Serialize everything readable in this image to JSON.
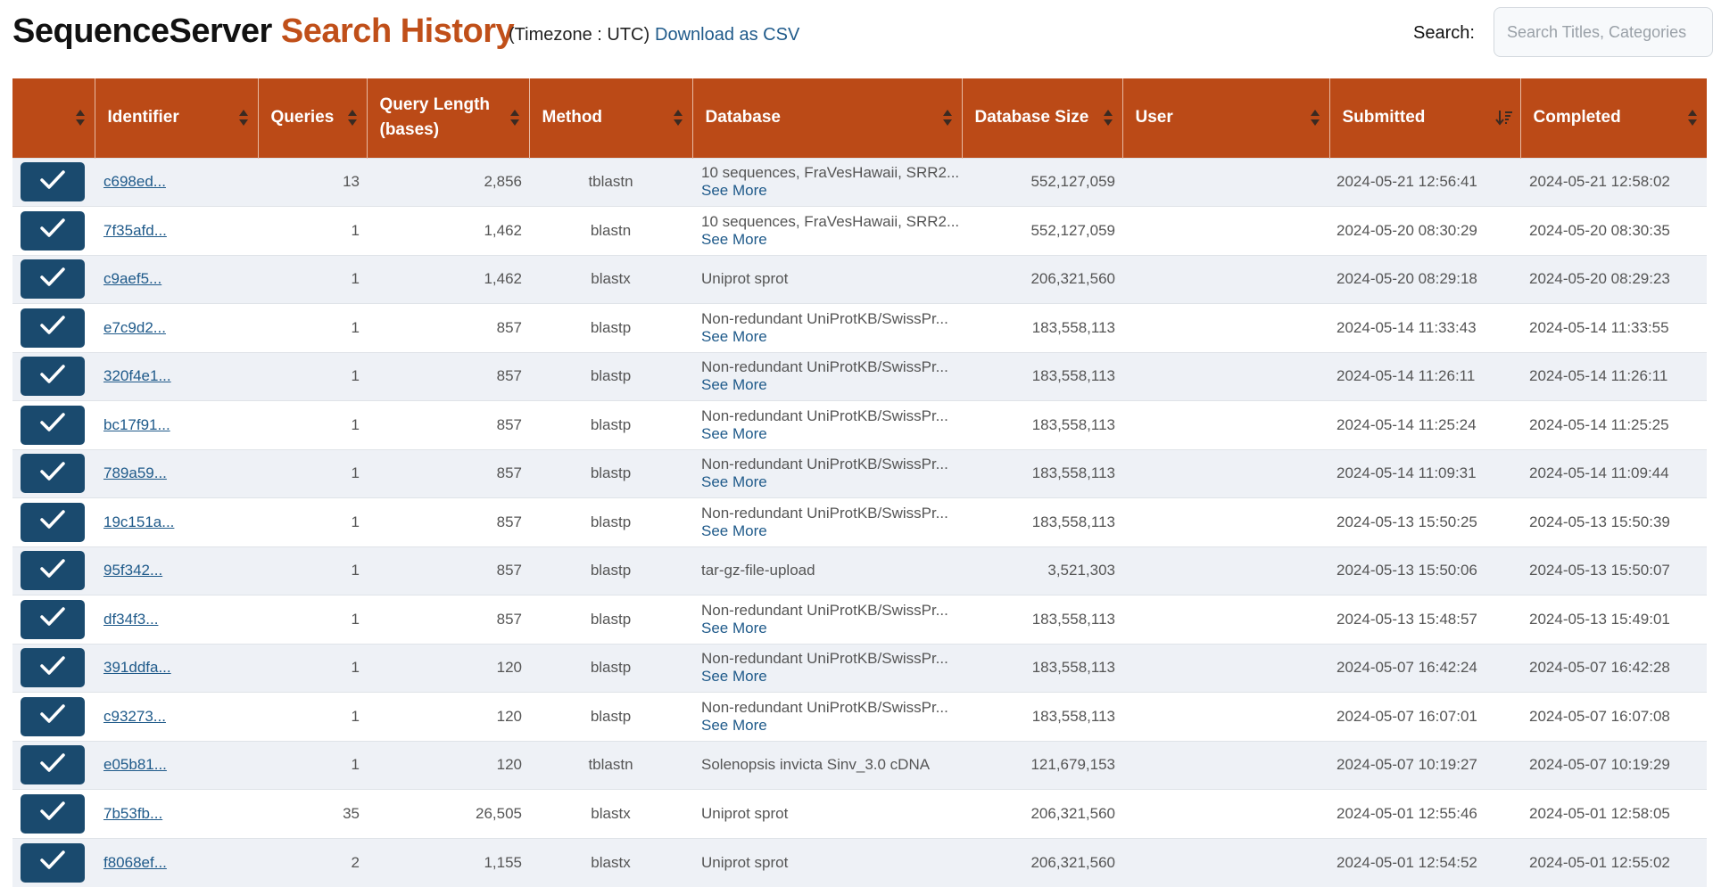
{
  "header": {
    "title_part1": "SequenceServer",
    "title_part2": "Search History",
    "timezone": "(Timezone : UTC)",
    "download_csv": "Download as CSV",
    "search_label": "Search:",
    "search_placeholder": "Search Titles, Categories",
    "search_value": ""
  },
  "colors": {
    "accent": "#bb4a17",
    "title_accent": "#c04f19",
    "link": "#1f5a8a",
    "checkbox": "#1a4a6e",
    "row_alt": "#eef1f6"
  },
  "table": {
    "columns": [
      {
        "label": "",
        "sort": "unsorted"
      },
      {
        "label": "Identifier",
        "sort": "unsorted"
      },
      {
        "label": "Queries",
        "sort": "unsorted"
      },
      {
        "label": "Query Length (bases)",
        "sort": "unsorted"
      },
      {
        "label": "Method",
        "sort": "unsorted"
      },
      {
        "label": "Database",
        "sort": "unsorted"
      },
      {
        "label": "Database Size",
        "sort": "unsorted"
      },
      {
        "label": "User",
        "sort": "unsorted"
      },
      {
        "label": "Submitted",
        "sort": "descending"
      },
      {
        "label": "Completed",
        "sort": "unsorted"
      }
    ],
    "see_more_label": "See More",
    "rows": [
      {
        "checked": true,
        "identifier": "c698ed...",
        "queries": "13",
        "query_length": "2,856",
        "method": "tblastn",
        "database": "10 sequences, FraVesHawaii, SRR2...",
        "see_more": true,
        "db_size": "552,127,059",
        "user": "",
        "submitted": "2024-05-21 12:56:41",
        "completed": "2024-05-21 12:58:02"
      },
      {
        "checked": true,
        "identifier": "7f35afd...",
        "queries": "1",
        "query_length": "1,462",
        "method": "blastn",
        "database": "10 sequences, FraVesHawaii, SRR2...",
        "see_more": true,
        "db_size": "552,127,059",
        "user": "",
        "submitted": "2024-05-20 08:30:29",
        "completed": "2024-05-20 08:30:35"
      },
      {
        "checked": true,
        "identifier": "c9aef5...",
        "queries": "1",
        "query_length": "1,462",
        "method": "blastx",
        "database": "Uniprot sprot",
        "see_more": false,
        "db_size": "206,321,560",
        "user": "",
        "submitted": "2024-05-20 08:29:18",
        "completed": "2024-05-20 08:29:23"
      },
      {
        "checked": true,
        "identifier": "e7c9d2...",
        "queries": "1",
        "query_length": "857",
        "method": "blastp",
        "database": "Non-redundant UniProtKB/SwissPr...",
        "see_more": true,
        "db_size": "183,558,113",
        "user": "",
        "submitted": "2024-05-14 11:33:43",
        "completed": "2024-05-14 11:33:55"
      },
      {
        "checked": true,
        "identifier": "320f4e1...",
        "queries": "1",
        "query_length": "857",
        "method": "blastp",
        "database": "Non-redundant UniProtKB/SwissPr...",
        "see_more": true,
        "db_size": "183,558,113",
        "user": "",
        "submitted": "2024-05-14 11:26:11",
        "completed": "2024-05-14 11:26:11"
      },
      {
        "checked": true,
        "identifier": "bc17f91...",
        "queries": "1",
        "query_length": "857",
        "method": "blastp",
        "database": "Non-redundant UniProtKB/SwissPr...",
        "see_more": true,
        "db_size": "183,558,113",
        "user": "",
        "submitted": "2024-05-14 11:25:24",
        "completed": "2024-05-14 11:25:25"
      },
      {
        "checked": true,
        "identifier": "789a59...",
        "queries": "1",
        "query_length": "857",
        "method": "blastp",
        "database": "Non-redundant UniProtKB/SwissPr...",
        "see_more": true,
        "db_size": "183,558,113",
        "user": "",
        "submitted": "2024-05-14 11:09:31",
        "completed": "2024-05-14 11:09:44"
      },
      {
        "checked": true,
        "identifier": "19c151a...",
        "queries": "1",
        "query_length": "857",
        "method": "blastp",
        "database": "Non-redundant UniProtKB/SwissPr...",
        "see_more": true,
        "db_size": "183,558,113",
        "user": "",
        "submitted": "2024-05-13 15:50:25",
        "completed": "2024-05-13 15:50:39"
      },
      {
        "checked": true,
        "identifier": "95f342...",
        "queries": "1",
        "query_length": "857",
        "method": "blastp",
        "database": "tar-gz-file-upload",
        "see_more": false,
        "db_size": "3,521,303",
        "user": "",
        "submitted": "2024-05-13 15:50:06",
        "completed": "2024-05-13 15:50:07"
      },
      {
        "checked": true,
        "identifier": "df34f3...",
        "queries": "1",
        "query_length": "857",
        "method": "blastp",
        "database": "Non-redundant UniProtKB/SwissPr...",
        "see_more": true,
        "db_size": "183,558,113",
        "user": "",
        "submitted": "2024-05-13 15:48:57",
        "completed": "2024-05-13 15:49:01"
      },
      {
        "checked": true,
        "identifier": "391ddfa...",
        "queries": "1",
        "query_length": "120",
        "method": "blastp",
        "database": "Non-redundant UniProtKB/SwissPr...",
        "see_more": true,
        "db_size": "183,558,113",
        "user": "",
        "submitted": "2024-05-07 16:42:24",
        "completed": "2024-05-07 16:42:28"
      },
      {
        "checked": true,
        "identifier": "c93273...",
        "queries": "1",
        "query_length": "120",
        "method": "blastp",
        "database": "Non-redundant UniProtKB/SwissPr...",
        "see_more": true,
        "db_size": "183,558,113",
        "user": "",
        "submitted": "2024-05-07 16:07:01",
        "completed": "2024-05-07 16:07:08"
      },
      {
        "checked": true,
        "identifier": "e05b81...",
        "queries": "1",
        "query_length": "120",
        "method": "tblastn",
        "database": "Solenopsis invicta Sinv_3.0 cDNA",
        "see_more": false,
        "db_size": "121,679,153",
        "user": "",
        "submitted": "2024-05-07 10:19:27",
        "completed": "2024-05-07 10:19:29"
      },
      {
        "checked": true,
        "identifier": "7b53fb...",
        "queries": "35",
        "query_length": "26,505",
        "method": "blastx",
        "database": "Uniprot sprot",
        "see_more": false,
        "db_size": "206,321,560",
        "user": "",
        "submitted": "2024-05-01 12:55:46",
        "completed": "2024-05-01 12:58:05"
      },
      {
        "checked": true,
        "identifier": "f8068ef...",
        "queries": "2",
        "query_length": "1,155",
        "method": "blastx",
        "database": "Uniprot sprot",
        "see_more": false,
        "db_size": "206,321,560",
        "user": "",
        "submitted": "2024-05-01 12:54:52",
        "completed": "2024-05-01 12:55:02"
      }
    ]
  }
}
